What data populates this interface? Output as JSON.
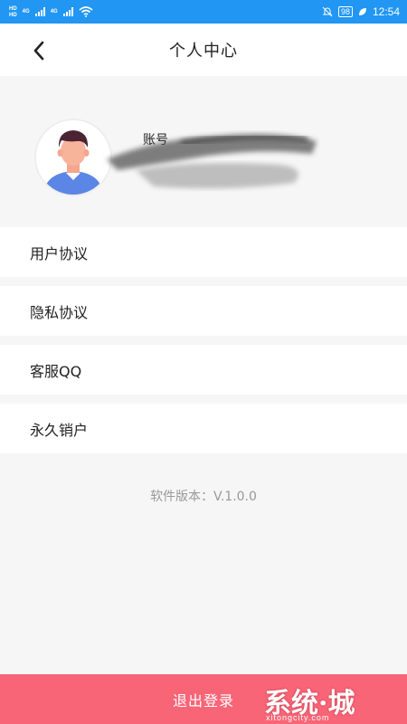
{
  "status_bar": {
    "hd1": "HD",
    "hd2": "HD",
    "net1": "4G",
    "net2": "4G",
    "battery": "98",
    "time": "12:54"
  },
  "nav": {
    "title": "个人中心",
    "back_icon": "chevron-left-icon"
  },
  "profile": {
    "account_label": "账号",
    "account_value_redacted": true
  },
  "menu": [
    {
      "label": "用户协议"
    },
    {
      "label": "隐私协议"
    },
    {
      "label": "客服QQ"
    },
    {
      "label": "永久销户"
    }
  ],
  "version_text": "软件版本：V.1.0.0",
  "logout_label": "退出登录",
  "watermark": {
    "main": "系统·城",
    "sub": "xitongcity.com"
  },
  "colors": {
    "status_bar": "#2196f3",
    "logout": "#f76577",
    "background": "#f6f6f6"
  }
}
